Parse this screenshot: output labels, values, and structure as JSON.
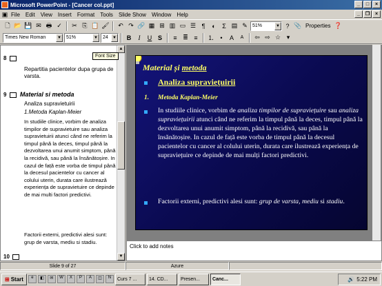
{
  "window": {
    "title": "Microsoft PowerPoint - [Cancer col.ppt]"
  },
  "menu": [
    "File",
    "Edit",
    "View",
    "Insert",
    "Format",
    "Tools",
    "Slide Show",
    "Window",
    "Help"
  ],
  "toolbar": {
    "zoom": "51%",
    "properties_label": "Properties",
    "font_name": "Times New Roman",
    "font_size": "24",
    "tooltip": "Font Size"
  },
  "outline": {
    "slide8_num": "8",
    "slide8_bullet": "Repartitia pacientelor dupa grupa de varsta.",
    "slide9_num": "9",
    "slide9_title": "Material si metoda",
    "slide9_b1": "Analiza supravietuirii",
    "slide9_b2": "1.Metoda Kaplan-Meier",
    "slide9_b3": "In studiile clinice, vorbim de analiza timpilor de supravietuire sau analiza supravietuirii atunci când ne referim la timpul până la deces, timpul până la dezvoltarea unui anumit simptom, până la recidivă, sau până la însănătoșire. In cazul de față este vorba de timpul până la decesul pacientelor cu cancer al colului uterin, durata care ilustrează experiența de supravietuire ce depinde de mai multi factori predictivi.",
    "slide9_b4": "Factorii externi, predictivi alesi sunt: grup de varsta, mediu si stadiu.",
    "slide10_num": "10"
  },
  "slide": {
    "title_a": "Material și ",
    "title_b": "metoda",
    "bullet1": "Analiza supraviețuirii",
    "num1": "1.",
    "sub1": "Metoda Kaplan-Meier",
    "p1_a": "In studiile clinice, vorbim de ",
    "p1_b": "analiza timpilor de supraviețuire",
    "p1_c": " sau ",
    "p1_d": "analiza supraviețuirii",
    "p1_e": " atunci când ne referim la timpul până la deces, timpul până la dezvoltarea unui anumit simptom, până la recidivă, sau până la însănătoșire. In cazul de față este vorba de timpul până la decesul pacientelor cu cancer al colului uterin, durata care ilustrează experiența de supraviețuire ce depinde de mai mulți factori predictivi.",
    "p2_a": "Factorii externi, predictivi alesi sunt: ",
    "p2_b": "grup de varsta, mediu",
    "p2_c": " si ",
    "p2_d": "stadiu",
    "p2_e": "."
  },
  "notes": {
    "placeholder": "Click to add notes"
  },
  "status": {
    "slide": "Slide 9 of 27",
    "design": "Azure"
  },
  "taskbar": {
    "start": "Start",
    "tasks": [
      "Curs 7 ...",
      "14. CD...",
      "Presen...",
      "Canc..."
    ],
    "clock": "5:22 PM"
  },
  "colors": {
    "title_bar": "#0a246a",
    "slide_bg": "#14147a",
    "slide_title": "#ffff66",
    "bullet": "#33aaff"
  }
}
